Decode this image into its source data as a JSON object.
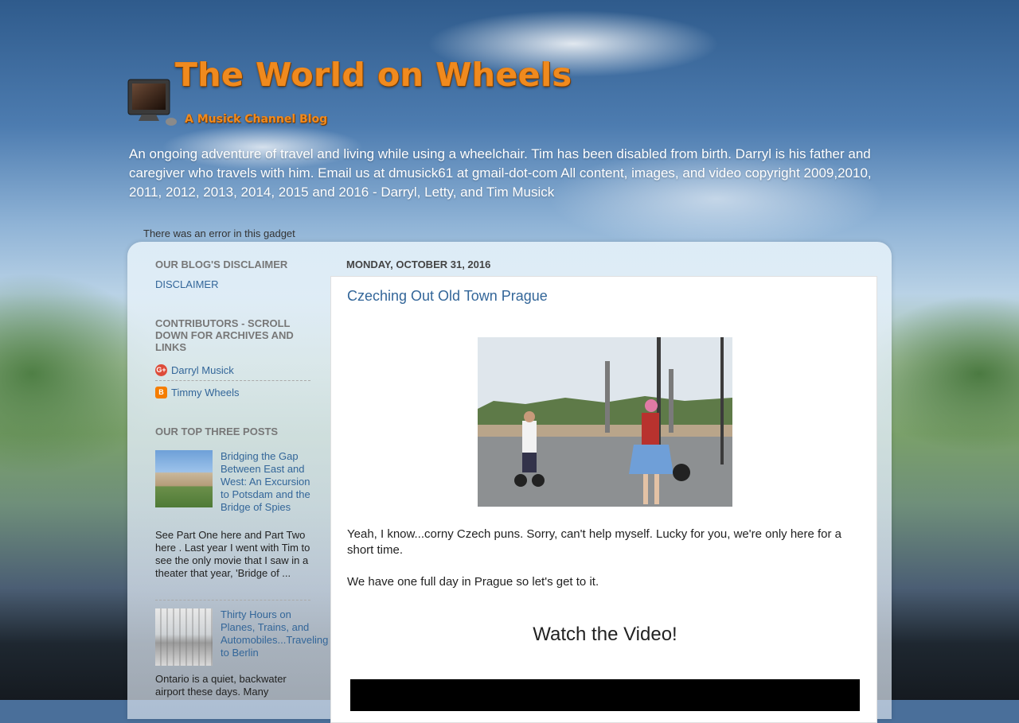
{
  "blog": {
    "title": "The World on Wheels",
    "subtitle": "A Musick Channel Blog",
    "description": "An ongoing adventure of travel and living while using a wheelchair. Tim has been disabled from birth. Darryl is his father and caregiver who travels with him. Email us at dmusick61 at gmail-dot-com All content, images, and video copyright 2009,2010, 2011, 2012, 2013, 2014, 2015 and 2016 - Darryl, Letty, and Tim Musick",
    "gadget_error": "There was an error in this gadget"
  },
  "sidebar": {
    "disclaimer": {
      "title": "OUR BLOG'S DISCLAIMER",
      "link": "DISCLAIMER"
    },
    "contributors": {
      "title": "CONTRIBUTORS - SCROLL DOWN FOR ARCHIVES AND LINKS",
      "items": [
        {
          "name": "Darryl Musick",
          "icon": "google-plus-icon"
        },
        {
          "name": "Timmy Wheels",
          "icon": "blogger-icon"
        }
      ]
    },
    "top_posts": {
      "title": "OUR TOP THREE POSTS",
      "items": [
        {
          "title": "Bridging the Gap Between East and West: An Excursion to Potsdam and the Bridge of Spies",
          "snippet": "See Part One here  and Part Two here . Last year I went with Tim to see the only movie that I saw in a theater that year, 'Bridge of ..."
        },
        {
          "title": "Thirty Hours on Planes, Trains, and Automobiles...Traveling to Berlin",
          "snippet": "Ontario is a quiet, backwater airport these days. Many"
        }
      ]
    }
  },
  "post": {
    "date": "MONDAY, OCTOBER 31, 2016",
    "title": "Czeching Out Old Town Prague",
    "paragraph1": "Yeah, I know...corny Czech puns. Sorry, can't help myself. Lucky for you, we're only here for a short time.",
    "paragraph2": "We have one full day in Prague so let's get to it.",
    "video_heading": "Watch the Video!"
  }
}
